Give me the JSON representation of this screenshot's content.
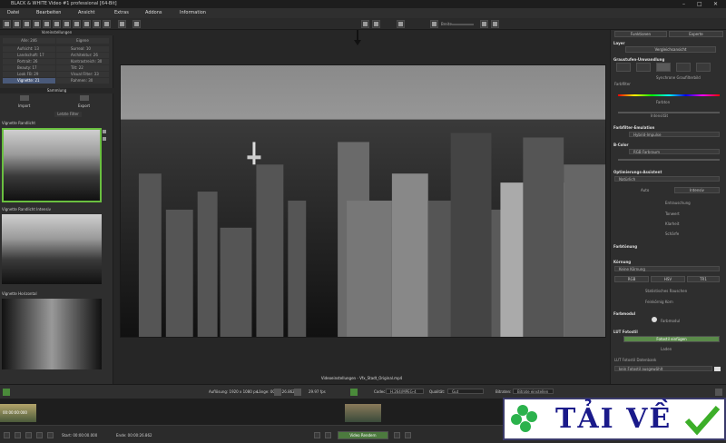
{
  "window": {
    "title": "BLACK & WHITE Video #1 professional [64-Bit]"
  },
  "menu": [
    "Datei",
    "Bearbeiten",
    "Ansicht",
    "Extras",
    "Addons",
    "Information"
  ],
  "toolbar": {
    "zoom_label": "Breite"
  },
  "left": {
    "header": "Voreinstellungen",
    "tabs": [
      "Alle: 246",
      "Eigene"
    ],
    "categories": [
      [
        "Aufsicht: 13",
        "Surreal: 10"
      ],
      [
        "Landschaft: 17",
        "Architektur: 26"
      ],
      [
        "Portrait: 26",
        "Kontrastreich: 30"
      ],
      [
        "Beauty: 17",
        "Tilt: 22"
      ],
      [
        "Look FB: 29",
        "Visual Filter: 33"
      ],
      [
        "Vignette: 21",
        "Rahmen: 30"
      ]
    ],
    "sub_header": "Sammlung",
    "import_label": "Import",
    "export_label": "Export",
    "filter_label": "Letzte Filter",
    "presets": [
      "Vignette Randlicht",
      "Vignette Randlicht Intensiv",
      "Vignette Horizontal"
    ]
  },
  "right": {
    "tabs": [
      "Funktionen",
      "Experte"
    ],
    "sect_layer": "Layer",
    "btn_compare": "Vergleichsansicht",
    "sect_conversion": "Graustufen-Umwandlung",
    "chk_syncpreset": "Synchrone Graufilterbild",
    "lbl_colorfilter": "Farbfilter",
    "lbl_color": "Farbton",
    "lbl_intensity": "Intensität",
    "sect_emulation": "Farbfilter-Emulation",
    "dd_emulation": "Hybrid-Impulse",
    "sect_tint": "B-Color",
    "dd_tint": "RGB Farbraum",
    "sect_grain": "Optimierungs-Assistent",
    "dd_grain": "Natürlich",
    "btn_auto": "Auto",
    "btn_extra": "Intensiv",
    "opt1": "Entrauschung",
    "opt2": "Tonwert",
    "opt3": "Klarheit",
    "opt4": "Schärfe",
    "sect_tone": "Farbtönung",
    "sect_blur": "Körnung",
    "dd_blur": "Keine Körnung",
    "btn_rgb": "RGB",
    "btn_hsv": "HSV",
    "btn_tone": "TR1",
    "sect_stat": "Statistisches Rauschen",
    "lbl_grain2": "Feinkörnig Korn",
    "sect_color": "Farbmodul",
    "btn_color": "Farbmodul",
    "sect_lut": "LUT Fotostil",
    "btn_lut": "Fotostil einfügen",
    "btn_lut2": "Laden",
    "sect_lut_file": "LUT Fotostil Datenbank",
    "dd_lut_file": "kein Fotostil ausgewählt"
  },
  "center": {
    "video_title": "Videoeinstellungen - Vfx_Stadt_Original.mp4"
  },
  "bottom": {
    "resolution": "Auflösung: 1920 x 1080 px",
    "length": "Länge: 00:00:26.862",
    "fps": "29.97 fps",
    "codec_label": "Codec:",
    "codec_value": "H.264/MPEG-4",
    "quality_label": "Qualität:",
    "quality_value": "Gut",
    "bitrate_label": "Bitraten:",
    "bitrate_value": "Bitrate einstellen"
  },
  "timeline": {
    "timecode": "00:00:00:000"
  },
  "footer": {
    "start_time": "Start: 00:00:00.000",
    "end_time": "Ende: 00:00:26.862",
    "render_label": "Video Rendern"
  },
  "badge": {
    "text": "TẢI VỀ"
  }
}
